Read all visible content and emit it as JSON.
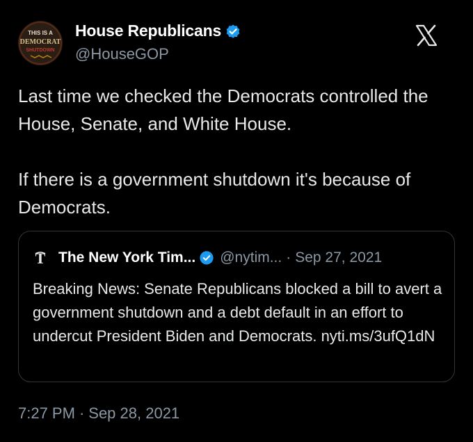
{
  "author": {
    "display_name": "House Republicans",
    "handle": "@HouseGOP",
    "avatar_text": [
      "THIS IS A",
      "DEMOCRAT",
      "SHUTDOWN"
    ],
    "verified_icon": "verified-badge-icon",
    "verified_color": "#1d9bf0"
  },
  "platform_icon": "x-logo-icon",
  "tweet": {
    "paragraphs": [
      "Last time we checked the Democrats controlled the House, Senate, and White House.",
      "If there is a government shutdown it's because of Democrats."
    ]
  },
  "quoted_tweet": {
    "outlet_icon": "nyt-logo-icon",
    "display_name": "The New York Tim...",
    "handle": "@nytim...",
    "separator": "·",
    "date": "Sep 27, 2021",
    "text": "Breaking News: Senate Republicans blocked a bill to avert a government shutdown and a debt default in an effort to undercut President Biden and Democrats. nyti.ms/3ufQ1dN"
  },
  "meta": {
    "time": "7:27 PM",
    "separator": "·",
    "date": "Sep 28, 2021"
  },
  "colors": {
    "background": "#000000",
    "text_primary": "#e7e9ea",
    "text_secondary": "#8b98a5",
    "border": "#333639",
    "verified": "#1d9bf0"
  }
}
